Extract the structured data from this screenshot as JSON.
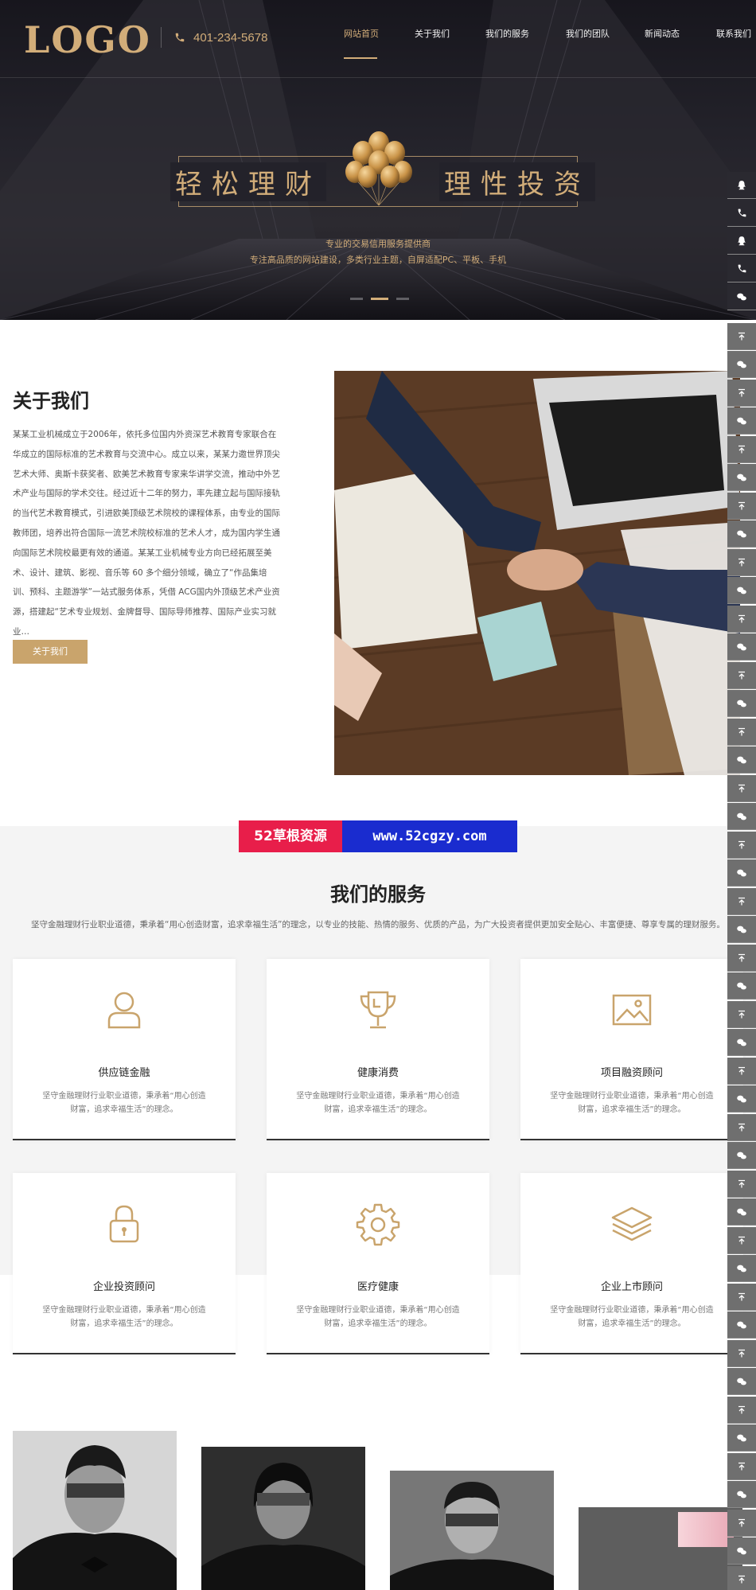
{
  "header": {
    "logo": "LOGO",
    "phone": "401-234-5678",
    "nav": [
      {
        "label": "网站首页",
        "active": true
      },
      {
        "label": "关于我们"
      },
      {
        "label": "我们的服务"
      },
      {
        "label": "我们的团队"
      },
      {
        "label": "新闻动态"
      },
      {
        "label": "联系我们"
      }
    ]
  },
  "hero": {
    "left_text": "轻松理财",
    "right_text": "理性投资",
    "subtitle": "专业的交易信用服务提供商",
    "tagline": "专注高品质的网站建设，多类行业主题，自屏适配PC、平板、手机",
    "slides": 3,
    "active_slide": 2
  },
  "about": {
    "title": "关于我们",
    "text": "某某工业机械成立于2006年，依托多位国内外资深艺术教育专家联合在华成立的国际标准的艺术教育与交流中心。成立以来，某某力邀世界顶尖艺术大师、奥斯卡获奖者、欧美艺术教育专家来华讲学交流，推动中外艺术产业与国际的学术交往。经过近十二年的努力，率先建立起与国际接轨的当代艺术教育模式，引进欧美顶级艺术院校的课程体系，由专业的国际教师团，培养出符合国际一流艺术院校标准的艺术人才，成为国内学生通向国际艺术院校最更有效的通道。某某工业机械专业方向已经拓展至美术、设计、建筑、影视、音乐等 60 多个细分领域，确立了“作品集培训、预科、主题游学”一站式服务体系，凭借 ACG国内外顶级艺术产业资源，搭建起“艺术专业规划、金牌督导、国际导师推荐、国际产业实习就业…",
    "button": "关于我们"
  },
  "watermark": {
    "left": "52草根资源",
    "right": "www.52cgzy.com"
  },
  "services": {
    "title": "我们的服务",
    "desc": "坚守金融理财行业职业道德，秉承着“用心创造财富，追求幸福生活”的理念，以专业的技能、热情的服务、优质的产品，为广大投资者提供更加安全贴心、丰富便捷、尊享专属的理财服务。",
    "cards": [
      {
        "title": "供应链金融",
        "desc": "坚守金融理财行业职业道德，秉承着“用心创造财富，追求幸福生活”的理念。",
        "icon": "user-icon"
      },
      {
        "title": "健康消费",
        "desc": "坚守金融理财行业职业道德，秉承着“用心创造财富，追求幸福生活”的理念。",
        "icon": "trophy-icon"
      },
      {
        "title": "项目融资顾问",
        "desc": "坚守金融理财行业职业道德，秉承着“用心创造财富，追求幸福生活”的理念。",
        "icon": "image-icon"
      },
      {
        "title": "企业投资顾问",
        "desc": "坚守金融理财行业职业道德，秉承着“用心创造财富，追求幸福生活”的理念。",
        "icon": "lock-icon"
      },
      {
        "title": "医疗健康",
        "desc": "坚守金融理财行业职业道德，秉承着“用心创造财富，追求幸福生活”的理念。",
        "icon": "gear-icon"
      },
      {
        "title": "企业上市顾问",
        "desc": "坚守金融理财行业职业道德，秉承着“用心创造财富，追求幸福生活”的理念。",
        "icon": "layers-icon"
      }
    ]
  },
  "colors": {
    "gold": "#d2ad79",
    "button_gold": "#c9a46c",
    "hero_dark": "#1d1c22",
    "sidebar_grey": "#6f6f6f"
  }
}
